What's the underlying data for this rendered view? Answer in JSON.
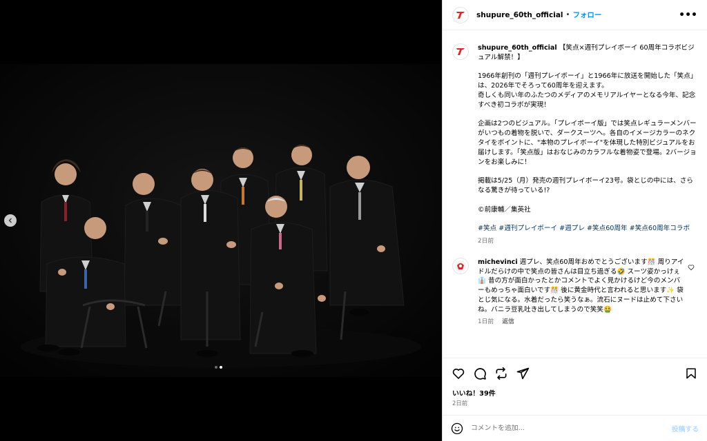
{
  "account": {
    "username": "shupure_60th_official",
    "follow_label": "フォロー",
    "dot": "•",
    "more": "•••"
  },
  "post": {
    "username": "shupure_60th_official",
    "title": " 【笑点×週刊プレイボーイ 60周年コラボビジュアル解禁！】",
    "p1": "1966年創刊の「週刊プレイボーイ」と1966年に放送を開始した「笑点」は、2026年でそろって60周年を迎えます。\n奇しくも同い年のふたつのメディアのメモリアルイヤーとなる今年、記念すべき初コラボが実現！",
    "p2": "企画は2つのビジュアル。「プレイボーイ版」では笑点レギュラーメンバーがいつもの着物を脱いで、ダークスーツへ。各自のイメージカラーのネクタイをポイントに、\"本物のプレイボーイ\"を体現した特別ビジュアルをお届けします。「笑点版」はおなじみのカラフルな着物姿で登場。2バージョンをお楽しみに！",
    "p3": "掲載は5/25（月）発売の週刊プレイボーイ23号。袋とじの中には、さらなる驚きが待っている!?",
    "credit": "©前康輔／集英社",
    "hashtags": "#笑点 #週刊プレイボーイ #週プレ #笑点60周年 #笑点60周年コラボ",
    "time": "2日前"
  },
  "comment": {
    "username": "michevinci",
    "text": " 週プレ、笑点60周年おめでとうございます🎊 周りアイドルだらけの中で笑点の皆さんは目立ち過ぎる🤣 スーツ姿かっけぇ👔 昔の方が面白かったとかコメントでよく見かけるけど今のメンバーもめっちゃ面白いです🎊 後に黄金時代と言われると思います✨ 袋とじ気になる。水着だったら笑うなぁ。流石にヌードは止めて下さいね。バニラ豆乳吐き出してしまうので笑笑🤮",
    "time": "1日前",
    "reply": "返信"
  },
  "stats": {
    "likes": "いいね！39件",
    "ago": "2日前"
  },
  "composer": {
    "placeholder": "コメントを追加...",
    "post_label": "投稿する"
  },
  "colors": {
    "brand_red": "#e8202a",
    "link_blue": "#0095f6",
    "hashtag_blue": "#00376b",
    "muted": "#737373"
  }
}
